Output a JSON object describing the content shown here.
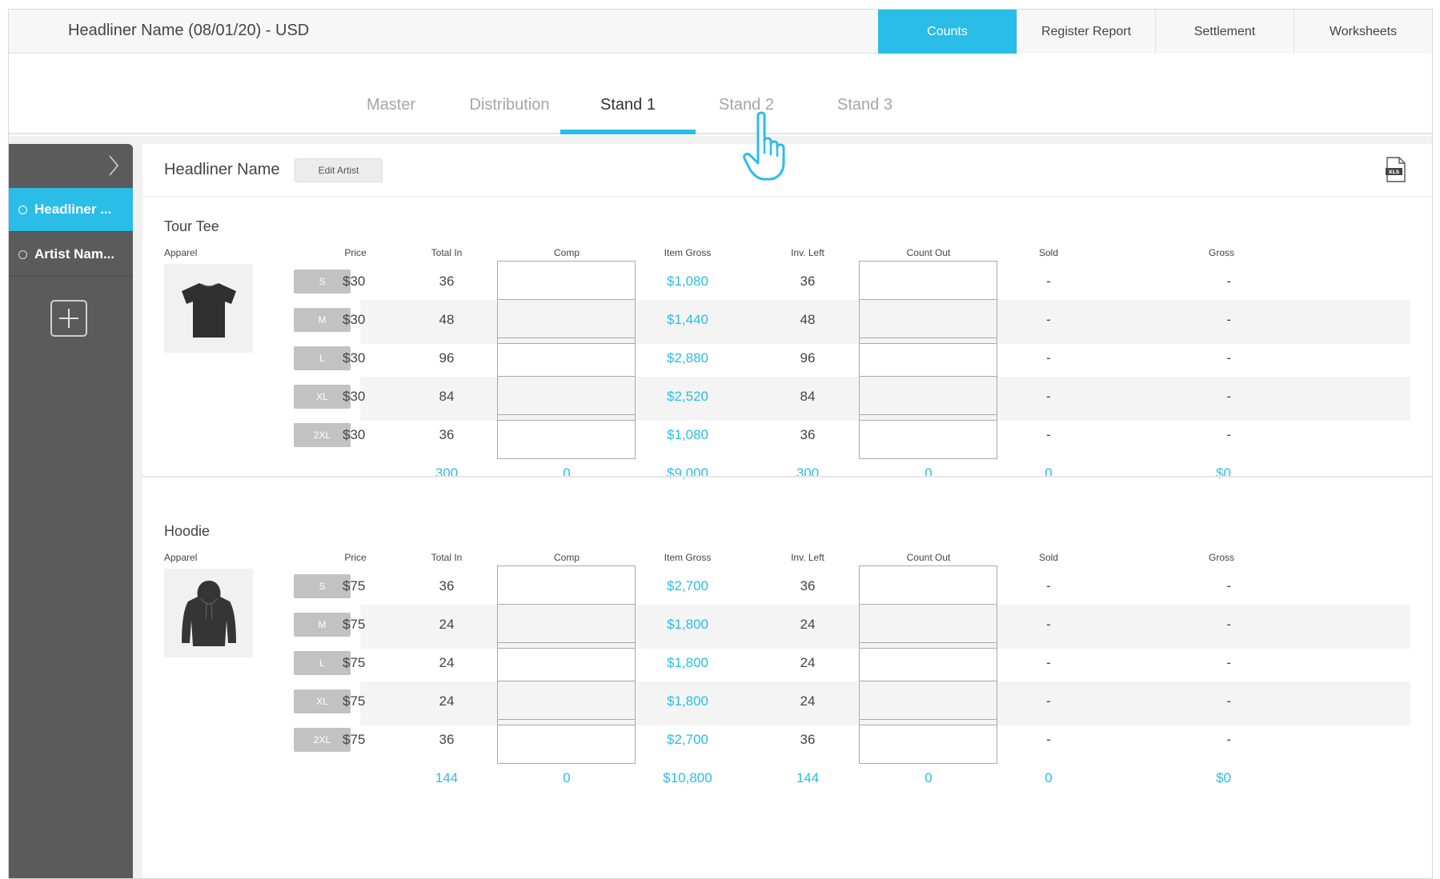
{
  "header": {
    "title": "Headliner Name (08/01/20) - USD",
    "tabs": [
      "Counts",
      "Register Report",
      "Settlement",
      "Worksheets"
    ],
    "active_tab": "Counts"
  },
  "subtabs": {
    "items": [
      "Master",
      "Distribution",
      "Stand 1",
      "Stand 2",
      "Stand 3"
    ],
    "active": "Stand 1"
  },
  "sidebar": {
    "items": [
      {
        "label": "Headliner ...",
        "active": true
      },
      {
        "label": "Artist Nam...",
        "active": false
      }
    ]
  },
  "card": {
    "artist_name": "Headliner Name",
    "edit_label": "Edit Artist",
    "xls_label": "XLS"
  },
  "columns": [
    "Price",
    "Total In",
    "Comp",
    "Item Gross",
    "Inv. Left",
    "Count Out",
    "Sold",
    "Gross"
  ],
  "products": [
    {
      "name": "Tour Tee",
      "category": "Apparel",
      "image": "t-shirt",
      "rows": [
        {
          "size": "S",
          "price": "$30",
          "total_in": "36",
          "item_gross": "$1,080",
          "inv_left": "36",
          "sold": "-",
          "gross": "-"
        },
        {
          "size": "M",
          "price": "$30",
          "total_in": "48",
          "item_gross": "$1,440",
          "inv_left": "48",
          "sold": "-",
          "gross": "-"
        },
        {
          "size": "L",
          "price": "$30",
          "total_in": "96",
          "item_gross": "$2,880",
          "inv_left": "96",
          "sold": "-",
          "gross": "-"
        },
        {
          "size": "XL",
          "price": "$30",
          "total_in": "84",
          "item_gross": "$2,520",
          "inv_left": "84",
          "sold": "-",
          "gross": "-"
        },
        {
          "size": "2XL",
          "price": "$30",
          "total_in": "36",
          "item_gross": "$1,080",
          "inv_left": "36",
          "sold": "-",
          "gross": "-"
        }
      ],
      "totals": {
        "total_in": "300",
        "comp": "0",
        "item_gross": "$9,000",
        "inv_left": "300",
        "count_out": "0",
        "sold": "0",
        "gross": "$0"
      }
    },
    {
      "name": "Hoodie",
      "category": "Apparel",
      "image": "hoodie",
      "rows": [
        {
          "size": "S",
          "price": "$75",
          "total_in": "36",
          "item_gross": "$2,700",
          "inv_left": "36",
          "sold": "-",
          "gross": "-"
        },
        {
          "size": "M",
          "price": "$75",
          "total_in": "24",
          "item_gross": "$1,800",
          "inv_left": "24",
          "sold": "-",
          "gross": "-"
        },
        {
          "size": "L",
          "price": "$75",
          "total_in": "24",
          "item_gross": "$1,800",
          "inv_left": "24",
          "sold": "-",
          "gross": "-"
        },
        {
          "size": "XL",
          "price": "$75",
          "total_in": "24",
          "item_gross": "$1,800",
          "inv_left": "24",
          "sold": "-",
          "gross": "-"
        },
        {
          "size": "2XL",
          "price": "$75",
          "total_in": "36",
          "item_gross": "$2,700",
          "inv_left": "36",
          "sold": "-",
          "gross": "-"
        }
      ],
      "totals": {
        "total_in": "144",
        "comp": "0",
        "item_gross": "$10,800",
        "inv_left": "144",
        "count_out": "0",
        "sold": "0",
        "gross": "$0"
      }
    }
  ],
  "colors": {
    "accent": "#29bde8",
    "sidebar": "#5b5b5b",
    "size_button": "#c2c2c2"
  },
  "icons": {
    "sidebar_toggle": "chevron-right-icon",
    "add": "plus-icon",
    "export": "xls-file-icon",
    "cursor": "hand-pointer-icon"
  }
}
